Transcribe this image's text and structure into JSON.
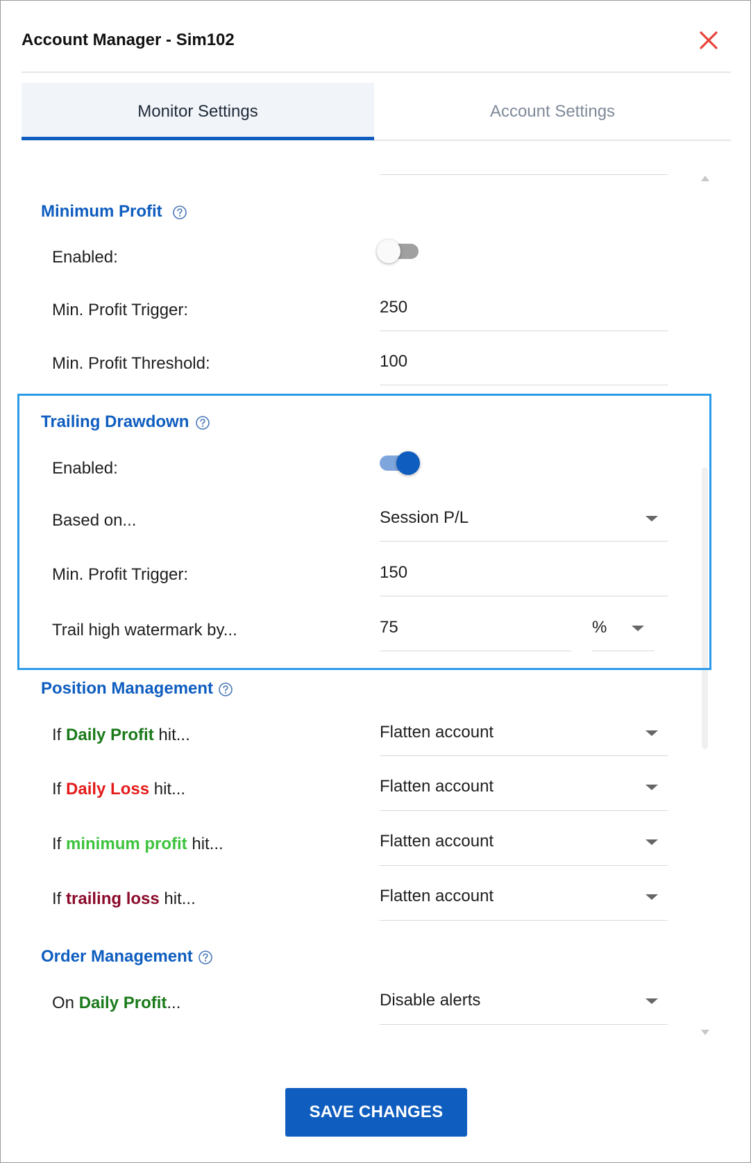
{
  "window": {
    "title": "Account Manager - Sim102"
  },
  "tabs": [
    {
      "label": "Monitor Settings",
      "active": true
    },
    {
      "label": "Account Settings",
      "active": false
    }
  ],
  "colors": {
    "accent": "#0e5dbf",
    "highlight_border": "#2a9be8",
    "close": "#e8433a",
    "daily_profit": "#1a7a1a",
    "daily_loss": "#e31b1b",
    "minimum_profit": "#3cc43c",
    "trailing_loss": "#8b0a2a"
  },
  "minimum_profit": {
    "title": "Minimum Profit",
    "enabled_label": "Enabled:",
    "enabled": false,
    "trigger_label": "Min. Profit Trigger:",
    "trigger_value": "250",
    "threshold_label": "Min. Profit Threshold:",
    "threshold_value": "100"
  },
  "trailing_drawdown": {
    "title": "Trailing Drawdown",
    "enabled_label": "Enabled:",
    "enabled": true,
    "based_on_label": "Based on...",
    "based_on_value": "Session P/L",
    "trigger_label": "Min. Profit Trigger:",
    "trigger_value": "150",
    "trail_label": "Trail high watermark by...",
    "trail_value": "75",
    "trail_unit": "%"
  },
  "position_management": {
    "title": "Position Management",
    "rows": [
      {
        "prefix": "If ",
        "keyword": "Daily Profit",
        "suffix": " hit...",
        "value": "Flatten account"
      },
      {
        "prefix": "If ",
        "keyword": "Daily Loss",
        "suffix": " hit...",
        "value": "Flatten account"
      },
      {
        "prefix": "If ",
        "keyword": "minimum profit",
        "suffix": " hit...",
        "value": "Flatten account"
      },
      {
        "prefix": "If ",
        "keyword": "trailing loss",
        "suffix": " hit...",
        "value": "Flatten account"
      }
    ]
  },
  "order_management": {
    "title": "Order Management",
    "rows": [
      {
        "prefix": "On ",
        "keyword": "Daily Profit",
        "suffix": "...",
        "value": "Disable alerts"
      }
    ]
  },
  "footer": {
    "save_label": "SAVE CHANGES"
  },
  "icons": {
    "close": "close-icon",
    "help": "help-icon",
    "dropdown": "chevron-down-icon"
  }
}
